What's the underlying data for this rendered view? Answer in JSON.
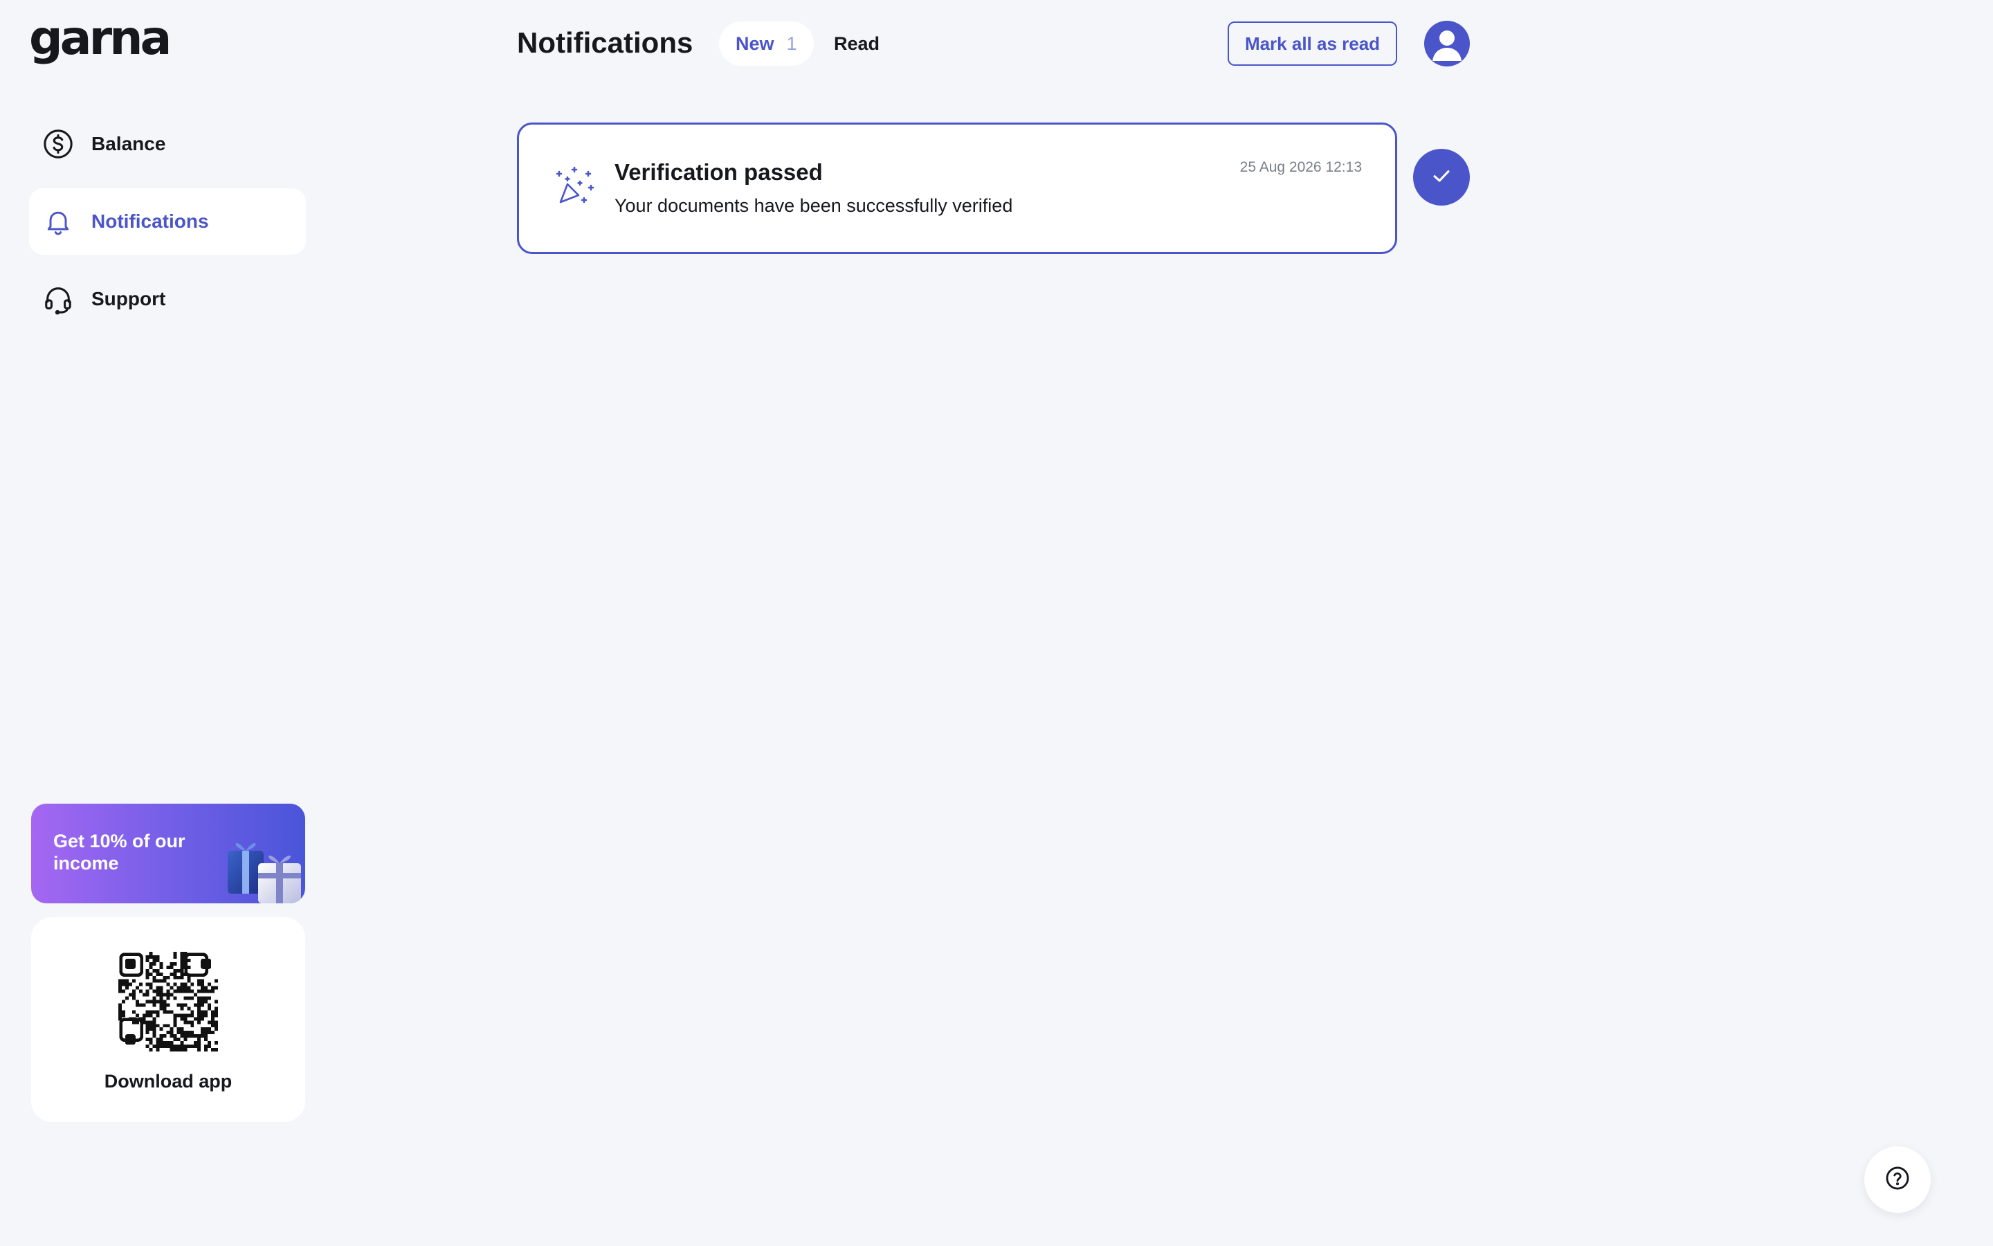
{
  "app": {
    "logo": "garna"
  },
  "sidebar": {
    "items": [
      {
        "label": "Balance",
        "icon": "dollar-circle-icon",
        "active": false
      },
      {
        "label": "Notifications",
        "icon": "bell-icon",
        "active": true
      },
      {
        "label": "Support",
        "icon": "headset-icon",
        "active": false
      }
    ],
    "promo": {
      "text": "Get 10% of our income",
      "icon": "gift-icon"
    },
    "download": {
      "label": "Download app",
      "icon": "qr-code-icon"
    }
  },
  "header": {
    "title": "Notifications",
    "tabs": [
      {
        "label": "New",
        "count": "1",
        "active": true
      },
      {
        "label": "Read",
        "active": false
      }
    ],
    "mark_all_label": "Mark all as read",
    "avatar_icon": "user-avatar-icon"
  },
  "notifications": [
    {
      "title": "Verification passed",
      "body": "Your documents have been successfully verified",
      "time": "25 Aug 2026 12:13",
      "icon": "party-popper-icon",
      "action_icon": "check-icon"
    }
  ],
  "help": {
    "icon": "question-circle-icon"
  },
  "colors": {
    "accent": "#4a55c9",
    "background": "#f4f6fa",
    "surface": "#ffffff",
    "text": "#16181d",
    "muted": "#7a7f88",
    "promo_gradient_start": "#a567f2",
    "promo_gradient_end": "#4a55d9"
  }
}
